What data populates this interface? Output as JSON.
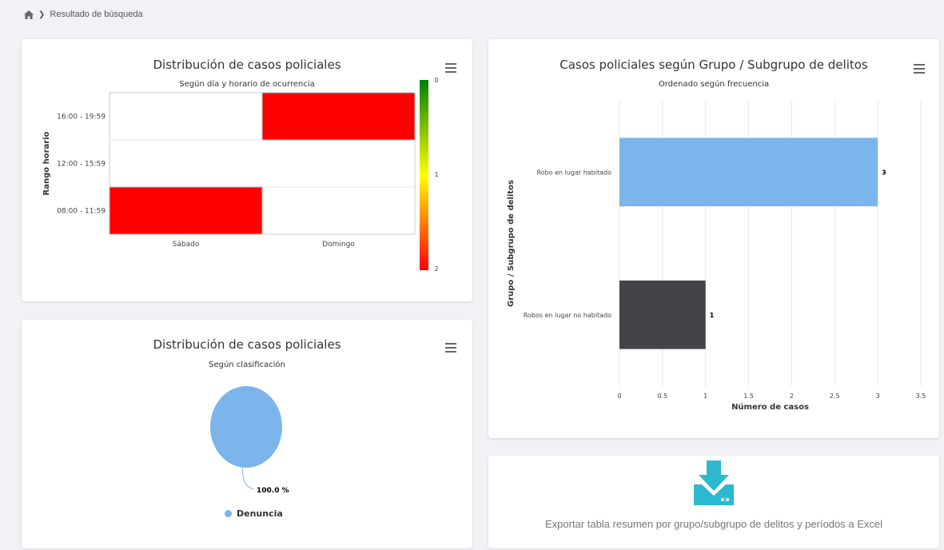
{
  "breadcrumb": {
    "current": "Resultado de búsqueda"
  },
  "heatmap_card": {
    "title": "Distribución de casos policiales",
    "subtitle": "Según día y horario de ocurrencia"
  },
  "pie_card": {
    "title": "Distribución de casos policiales",
    "subtitle": "Según clasificación"
  },
  "bar_card": {
    "title": "Casos policiales según Grupo / Subgrupo de delitos",
    "subtitle": "Ordenado según frecuencia"
  },
  "export_card": {
    "label": "Exportar tabla resumen por grupo/subgrupo de delitos y períodos a Excel",
    "icon": "download-icon",
    "icon_color": "#2db9cd"
  },
  "chart_data": [
    {
      "type": "heatmap",
      "title": "Distribución de casos policiales",
      "subtitle": "Según día y horario de ocurrencia",
      "xlabel": "",
      "ylabel": "Rango horario",
      "x_categories": [
        "Sábado",
        "Domingo"
      ],
      "y_categories": [
        "08:00 - 11:59",
        "12:00 - 15:59",
        "16:00 - 19:59"
      ],
      "cells": [
        {
          "x": "Sábado",
          "y": "08:00 - 11:59",
          "value": 2
        },
        {
          "x": "Domingo",
          "y": "16:00 - 19:59",
          "value": 2
        }
      ],
      "color_axis": {
        "min": 0,
        "max": 2,
        "ticks": [
          "0",
          "1",
          "2"
        ],
        "colors": [
          "#008000",
          "#ffff00",
          "#ff0000"
        ]
      },
      "empty_color": "#ffffff"
    },
    {
      "type": "pie",
      "title": "Distribución de casos policiales",
      "subtitle": "Según clasificación",
      "slices": [
        {
          "name": "Denuncia",
          "value": 100.0,
          "label": "100.0 %",
          "color": "#7cb5ec"
        }
      ],
      "legend": {
        "placement": "bottom"
      }
    },
    {
      "type": "bar",
      "orientation": "horizontal",
      "title": "Casos policiales según Grupo / Subgrupo de delitos",
      "subtitle": "Ordenado según frecuencia",
      "categories": [
        "Robo en lugar habitado",
        "Robos en lugar no habitado"
      ],
      "values": [
        3,
        1
      ],
      "value_labels": [
        "3",
        "1"
      ],
      "colors": [
        "#7cb5ec",
        "#434348"
      ],
      "xlabel": "Número de casos",
      "ylabel": "Grupo / Subgrupo de delitos",
      "xlim": [
        0,
        3.5
      ],
      "xticks": [
        "0",
        "0.5",
        "1",
        "1.5",
        "2",
        "2.5",
        "3",
        "3.5"
      ],
      "grid": true
    }
  ]
}
